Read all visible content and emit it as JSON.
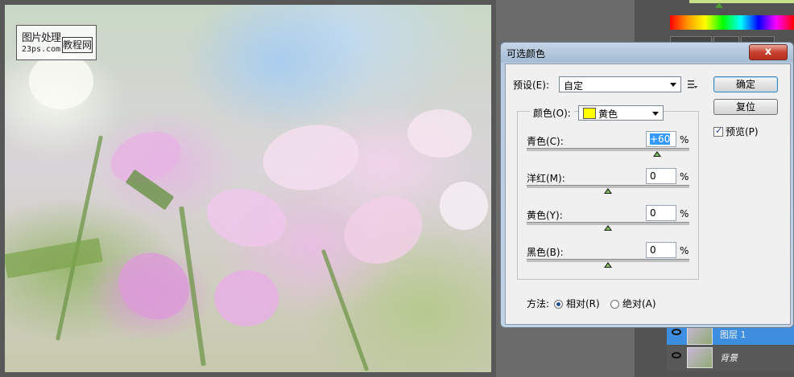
{
  "watermark": {
    "line1": "图片处理",
    "seal": "教程网",
    "line2": "23ps.com"
  },
  "layers": [
    {
      "name": "图层 1",
      "selected": true
    },
    {
      "name": "背景",
      "selected": false
    }
  ],
  "dialog": {
    "title": "可选颜色",
    "close_label": "x",
    "preset_label": "预设(E):",
    "preset_value": "自定",
    "preset_menu_icon": "list-menu-icon",
    "ok_label": "确定",
    "reset_label": "复位",
    "preview_label": "预览(P)",
    "preview_checked": true,
    "colors_label": "颜色(O):",
    "colors_value": "黄色",
    "colors_swatch": "#ffff00",
    "sliders": [
      {
        "label": "青色(C):",
        "value": "+60",
        "unit": "%",
        "level": 0.8,
        "highlighted": true
      },
      {
        "label": "洋红(M):",
        "value": "0",
        "unit": "%",
        "level": 0.5,
        "highlighted": false
      },
      {
        "label": "黄色(Y):",
        "value": "0",
        "unit": "%",
        "level": 0.5,
        "highlighted": false
      },
      {
        "label": "黑色(B):",
        "value": "0",
        "unit": "%",
        "level": 0.5,
        "highlighted": false
      }
    ],
    "method_label": "方法:",
    "method_options": [
      {
        "label": "相对(R)",
        "selected": true
      },
      {
        "label": "绝对(A)",
        "selected": false
      }
    ]
  }
}
